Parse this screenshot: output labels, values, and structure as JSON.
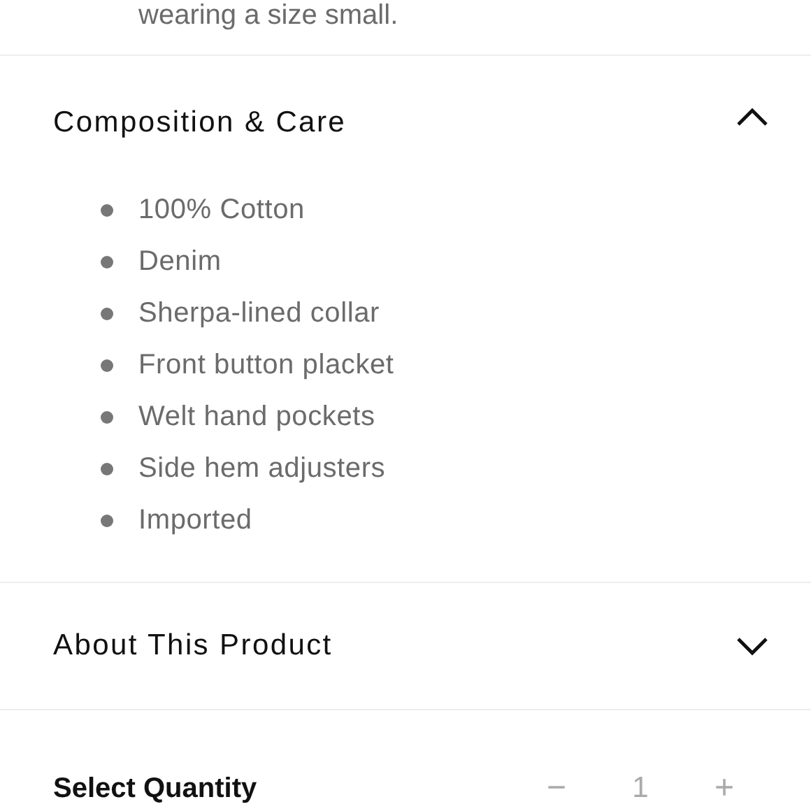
{
  "description_tail": "wearing a size small.",
  "sections": [
    {
      "title": "Composition & Care",
      "expanded": true,
      "items": [
        "100% Cotton",
        "Denim",
        "Sherpa-lined collar",
        "Front button placket",
        "Welt hand pockets",
        "Side hem adjusters",
        "Imported"
      ]
    },
    {
      "title": "About This Product",
      "expanded": false
    }
  ],
  "quantity": {
    "label": "Select Quantity",
    "decrement": "−",
    "value": "1",
    "increment": "+"
  }
}
